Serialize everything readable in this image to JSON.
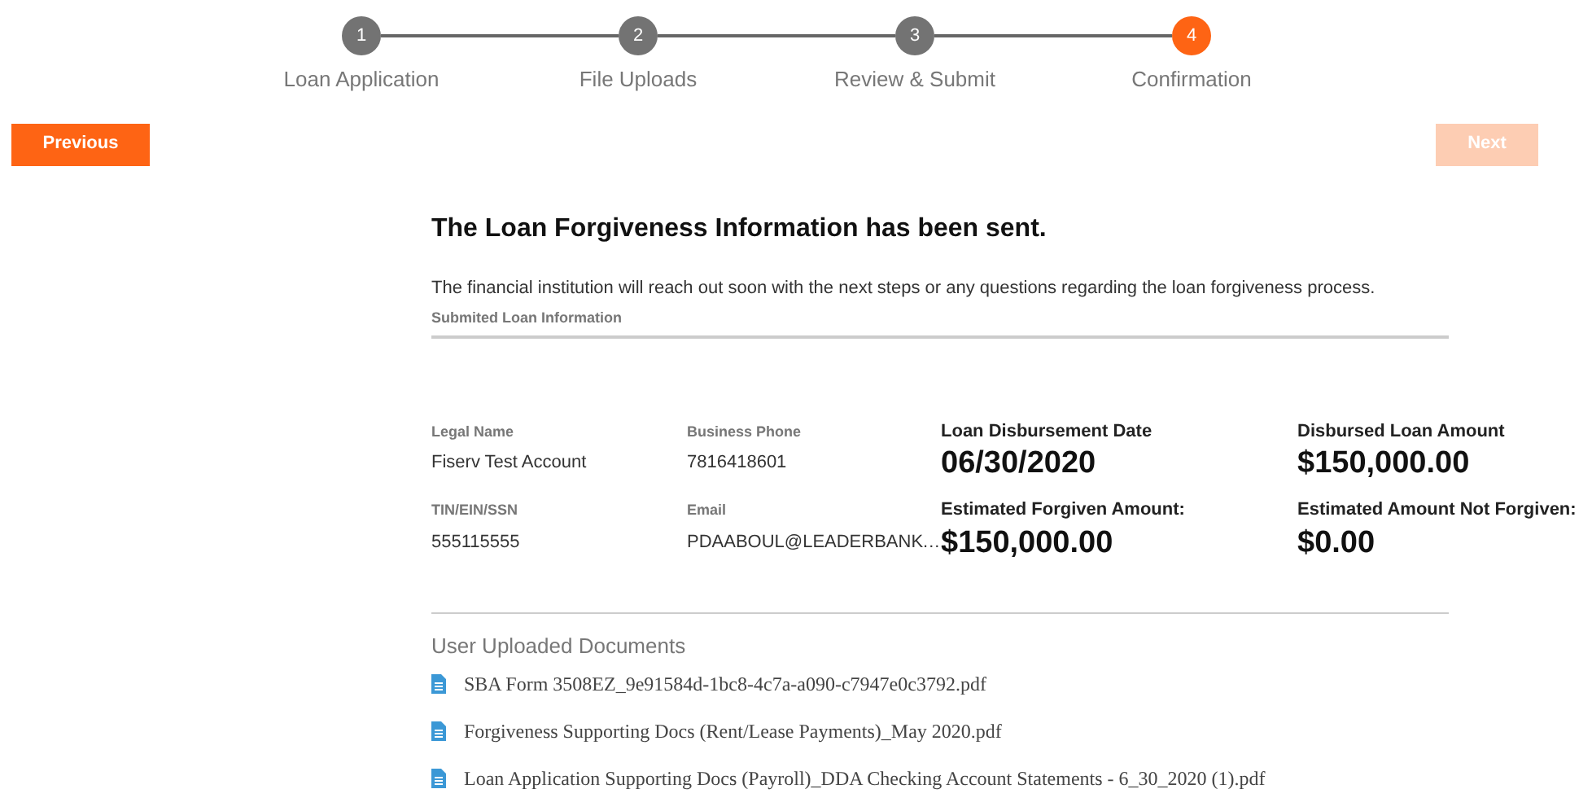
{
  "steps": [
    {
      "number": "1",
      "label": "Loan Application",
      "selected": false
    },
    {
      "number": "2",
      "label": "File Uploads",
      "selected": false
    },
    {
      "number": "3",
      "label": "Review & Submit",
      "selected": false
    },
    {
      "number": "4",
      "label": "Confirmation",
      "selected": true
    }
  ],
  "nav": {
    "previous": {
      "label": "Previous",
      "disabled": false
    },
    "next": {
      "label": "Next",
      "disabled": true
    }
  },
  "heading": "The Loan Forgiveness Information has been sent.",
  "message": "The financial institution will reach out soon with the next steps or any questions regarding the loan forgiveness process.",
  "section_title": "Submited Loan Information",
  "fields": [
    {
      "kind": "small",
      "label": "Legal Name",
      "value": "Fiserv Test Account"
    },
    {
      "kind": "small",
      "label": "Business Phone",
      "value": "7816418601"
    },
    {
      "kind": "large",
      "label": "Loan Disbursement Date",
      "value": "06/30/2020"
    },
    {
      "kind": "large",
      "label": "Disbursed Loan Amount",
      "value": "$150,000.00"
    },
    {
      "kind": "small",
      "label": "TIN/EIN/SSN",
      "value": "555115555"
    },
    {
      "kind": "small",
      "label": "Email",
      "value": "PDAABOUL@LEADERBANK.…"
    },
    {
      "kind": "large",
      "label": "Estimated Forgiven Amount:",
      "value": "$150,000.00"
    },
    {
      "kind": "large",
      "label": "Estimated Amount Not Forgiven:",
      "value": "$0.00"
    }
  ],
  "documents_title": "User Uploaded Documents",
  "documents": [
    "SBA Form 3508EZ_9e91584d-1bc8-4c7a-a090-c7947e0c3792.pdf",
    "Forgiveness Supporting Docs (Rent/Lease Payments)_May 2020.pdf",
    "Loan Application Supporting Docs (Payroll)_DDA Checking Account Statements - 6_30_2020 (1).pdf"
  ]
}
